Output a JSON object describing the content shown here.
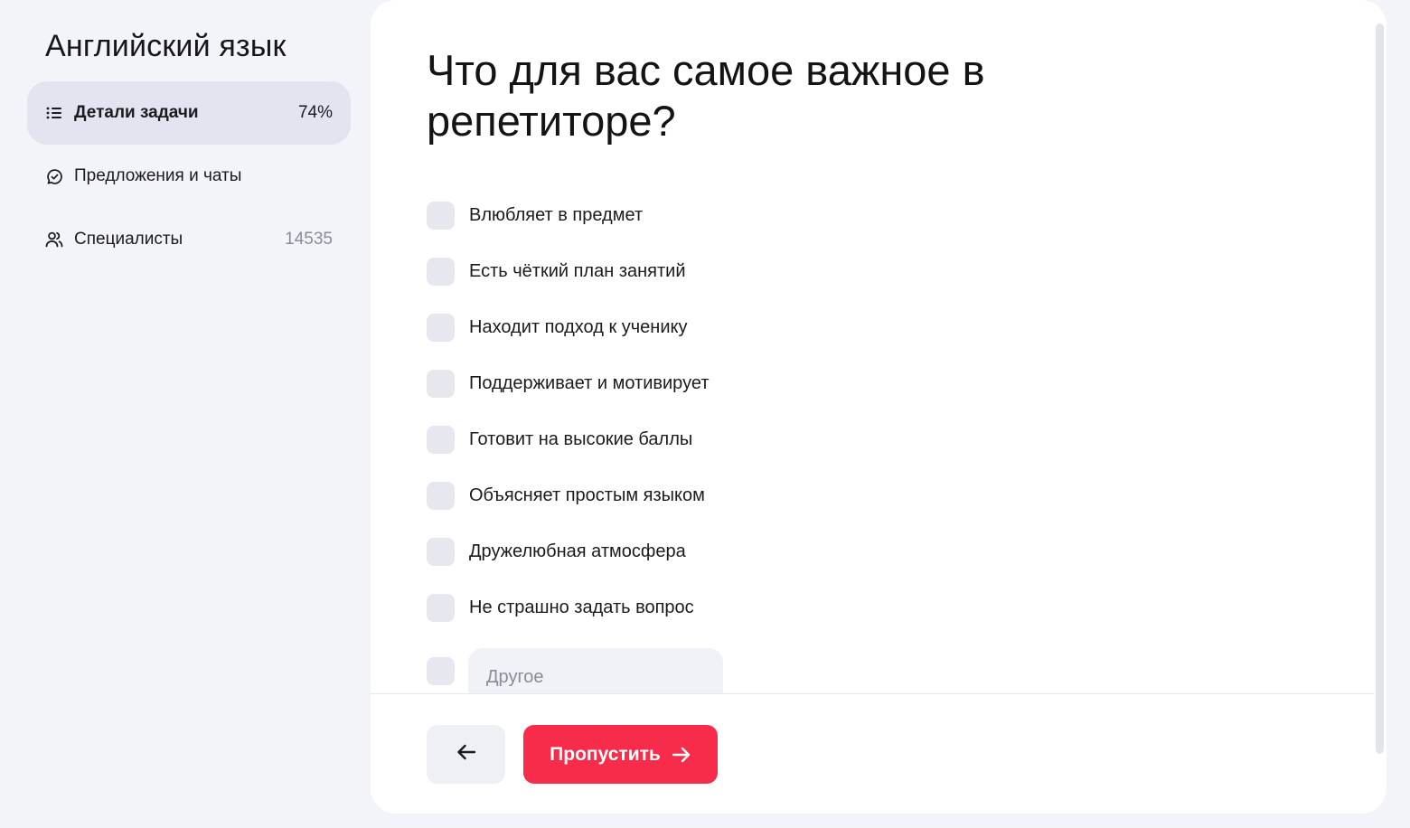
{
  "sidebar": {
    "title": "Английский язык",
    "items": [
      {
        "label": "Детали задачи",
        "meta": "74%",
        "icon": "list-icon",
        "active": true
      },
      {
        "label": "Предложения и чаты",
        "meta": "",
        "icon": "chat-check-icon",
        "active": false
      },
      {
        "label": "Специалисты",
        "meta": "14535",
        "icon": "users-icon",
        "active": false
      }
    ]
  },
  "main": {
    "question": "Что для вас самое важное в репетиторе?",
    "options": [
      "Влюбляет в предмет",
      "Есть чёткий план занятий",
      "Находит подход к ученику",
      "Поддерживает и мотивирует",
      "Готовит на высокие баллы",
      "Объясняет простым языком",
      "Дружелюбная атмосфера",
      "Не страшно задать вопрос"
    ],
    "other_placeholder": "Другое"
  },
  "footer": {
    "skip_label": "Пропустить",
    "back_icon": "arrow-left-icon",
    "skip_icon": "arrow-right-icon"
  },
  "colors": {
    "accent": "#f62c4a",
    "page_bg": "#f3f4f9",
    "active_nav_bg": "#e2e4ef",
    "checkbox_bg": "#e6e7ef"
  }
}
